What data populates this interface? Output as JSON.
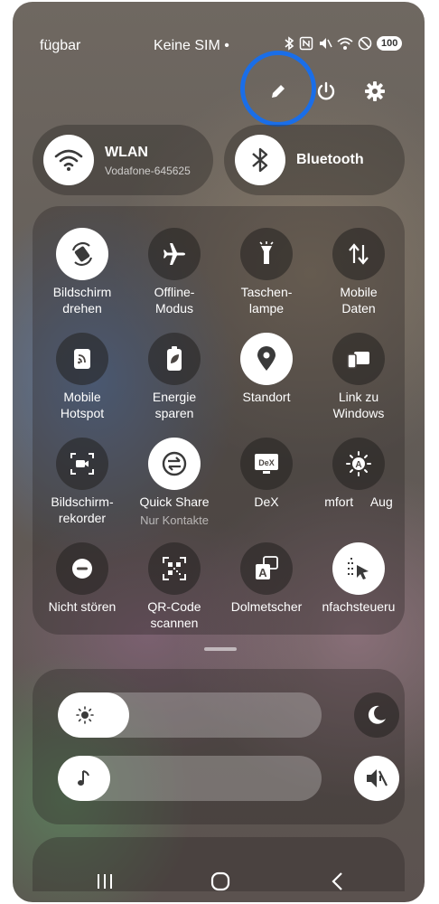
{
  "status_bar": {
    "left_text": "fügbar",
    "carrier": "Keine SIM •",
    "battery": "100"
  },
  "header": {
    "edit_icon": "pencil-icon",
    "power_icon": "power-icon",
    "settings_icon": "gear-icon",
    "highlight_color": "#1a6ee8"
  },
  "connectivity": {
    "wlan": {
      "title": "WLAN",
      "network": "Vodafone-645625"
    },
    "bluetooth": {
      "title": "Bluetooth"
    }
  },
  "tiles": [
    {
      "label": "Bildschirm\ndrehen",
      "icon": "rotate-icon",
      "active": true
    },
    {
      "label": "Offline-\nModus",
      "icon": "airplane-icon",
      "active": false
    },
    {
      "label": "Taschen-\nlampe",
      "icon": "flashlight-icon",
      "active": false
    },
    {
      "label": "Mobile\nDaten",
      "icon": "mobile-data-icon",
      "active": false
    },
    {
      "label": "Mobile\nHotspot",
      "icon": "hotspot-icon",
      "active": false
    },
    {
      "label": "Energie\nsparen",
      "icon": "battery-saver-icon",
      "active": false
    },
    {
      "label": "Standort",
      "icon": "location-icon",
      "active": true
    },
    {
      "label": "Link zu\nWindows",
      "icon": "link-windows-icon",
      "active": false
    },
    {
      "label": "Bildschirm-\nrekorder",
      "icon": "screen-recorder-icon",
      "active": false
    },
    {
      "label": "Quick Share",
      "sub": "Nur Kontakte",
      "icon": "quick-share-icon",
      "active": true
    },
    {
      "label": "DeX",
      "icon": "dex-icon",
      "active": false
    },
    {
      "label": "mfort     Aug",
      "icon": "eye-comfort-icon",
      "active": false
    },
    {
      "label": "Nicht stören",
      "icon": "do-not-disturb-icon",
      "active": false
    },
    {
      "label": "QR-Code\nscannen",
      "icon": "qr-scanner-icon",
      "active": false
    },
    {
      "label": "Dolmetscher",
      "icon": "interpreter-icon",
      "active": false
    },
    {
      "label": "nfachsteueru",
      "icon": "easy-control-icon",
      "active": true
    }
  ],
  "brightness": {
    "level": 0.27,
    "icon": "sun-icon",
    "side_icon": "moon-icon"
  },
  "volume": {
    "level": 0.2,
    "icon": "music-note-icon",
    "side_icon": "mute-icon"
  },
  "nav": {
    "recents": "recents-icon",
    "home": "home-icon",
    "back": "back-icon"
  }
}
